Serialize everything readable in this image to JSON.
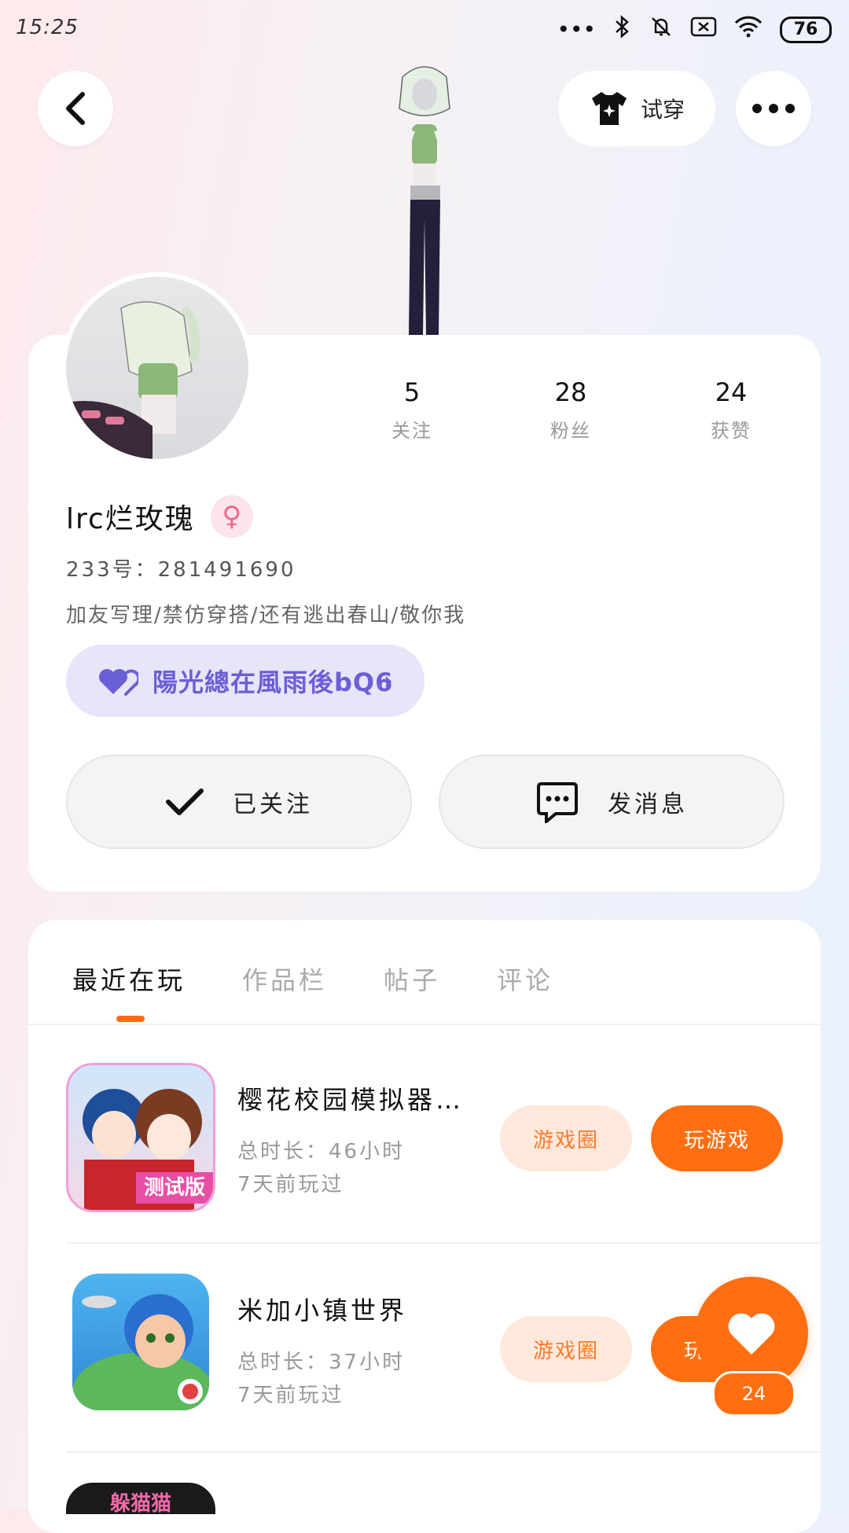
{
  "status_bar": {
    "time": "15:25",
    "battery": "76"
  },
  "header": {
    "try_on_label": "试穿"
  },
  "profile": {
    "stats": [
      {
        "value": "5",
        "label": "关注"
      },
      {
        "value": "28",
        "label": "粉丝"
      },
      {
        "value": "24",
        "label": "获赞"
      }
    ],
    "name": "lrc烂玫瑰",
    "uid": "233号：281491690",
    "bio": "加友写理/禁仿穿搭/还有逃出春山/敬你我",
    "relation": "陽光總在風雨後bQ6",
    "follow_label": "已关注",
    "message_label": "发消息"
  },
  "tabs": [
    {
      "label": "最近在玩"
    },
    {
      "label": "作品栏"
    },
    {
      "label": "帖子"
    },
    {
      "label": "评论"
    }
  ],
  "games": [
    {
      "title": "樱花校园模拟器…",
      "duration": "总时长：46小时",
      "last_played": "7天前玩过",
      "icon_badge": "测试版"
    },
    {
      "title": "米加小镇世界",
      "duration": "总时长：37小时",
      "last_played": "7天前玩过"
    }
  ],
  "game_buttons": {
    "circle": "游戏圈",
    "play": "玩游戏"
  },
  "partial_game": {
    "icon_text": "躲猫猫"
  },
  "like": {
    "count": "24"
  },
  "colors": {
    "accent": "#ff6f12",
    "relation": "#6b5fd6",
    "gender": "#f06a8a"
  }
}
